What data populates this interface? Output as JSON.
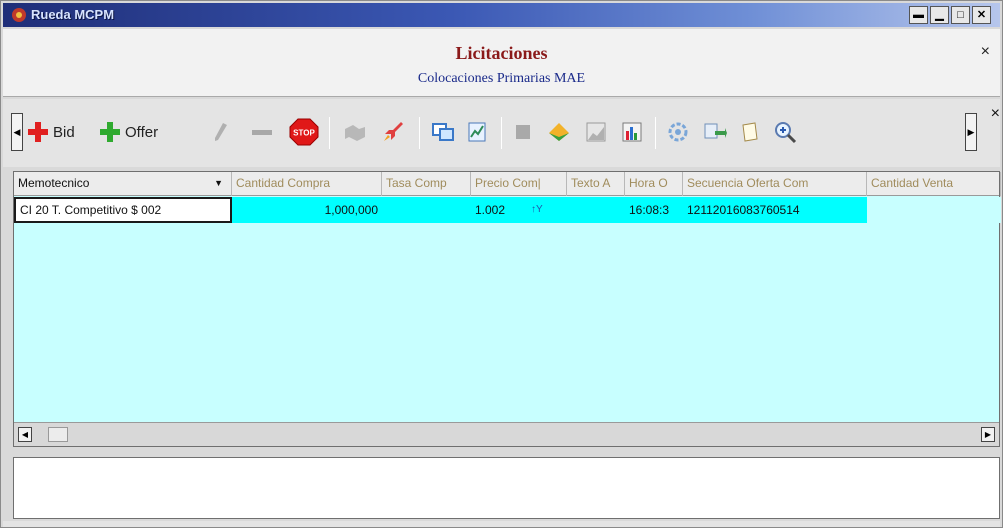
{
  "window": {
    "title": "Rueda MCPM",
    "controls": [
      "minimize",
      "restore",
      "maximize",
      "close"
    ]
  },
  "header": {
    "title": "Licitaciones",
    "subtitle": "Colocaciones Primarias MAE",
    "close_glyph": "×"
  },
  "toolbar": {
    "buttons": [
      {
        "icon": "red-plus-icon",
        "label": "Bid"
      },
      {
        "icon": "green-plus-icon",
        "label": "Offer"
      },
      {
        "icon": "pencil-icon",
        "label": ""
      },
      {
        "icon": "minus-icon",
        "label": ""
      },
      {
        "icon": "stop-icon",
        "label": "STOP"
      },
      {
        "icon": "handshake-icon",
        "label": ""
      },
      {
        "icon": "rocket-icon",
        "label": ""
      },
      {
        "icon": "copy-windows-icon",
        "label": ""
      },
      {
        "icon": "chart-page-icon",
        "label": ""
      },
      {
        "icon": "gray-square-icon",
        "label": ""
      },
      {
        "icon": "pyramid-icon",
        "label": ""
      },
      {
        "icon": "area-chart-icon",
        "label": ""
      },
      {
        "icon": "bar-chart-icon",
        "label": ""
      },
      {
        "icon": "gear-refresh-icon",
        "label": ""
      },
      {
        "icon": "export-icon",
        "label": ""
      },
      {
        "icon": "page-icon",
        "label": ""
      },
      {
        "icon": "zoom-in-icon",
        "label": ""
      }
    ],
    "close_glyph": "×"
  },
  "grid": {
    "columns": [
      "Memotecnico",
      "Cantidad Compra",
      "Tasa Comp",
      "Precio Com|",
      "Texto A",
      "Hora O",
      "Secuencia Oferta Com",
      "Cantidad Venta"
    ],
    "rows": [
      {
        "memotecnico": "CI 20 T. Competitivo  $    002",
        "cantidad_compra": "1,000,000",
        "tasa_comp": "",
        "precio_comp": "1.002",
        "precio_marker": "↑Y",
        "texto": "",
        "hora": "16:08:3",
        "secuencia": "12112016083760514",
        "cantidad_venta": ""
      }
    ]
  },
  "colors": {
    "grid_bg": "#c8ffff",
    "row_bg": "#00ffff",
    "header_title": "#8b1a1a",
    "header_subtitle": "#1a2a8a",
    "titlebar": "#2a3f9a"
  }
}
